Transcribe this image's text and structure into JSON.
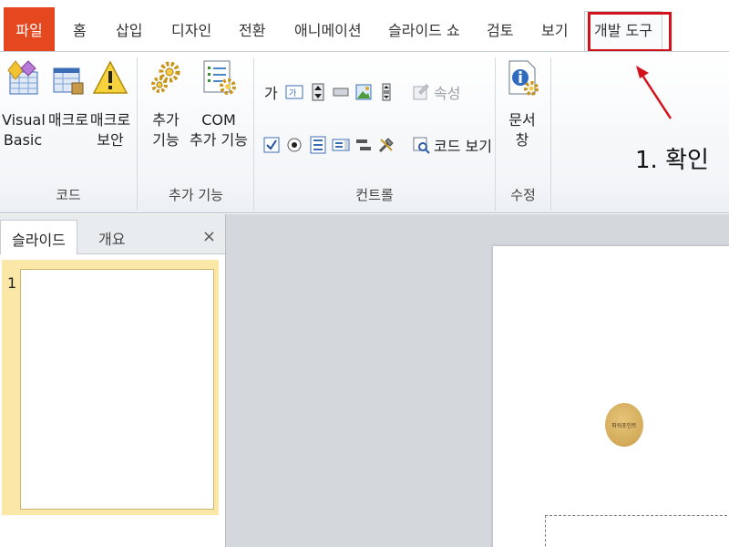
{
  "tabs": {
    "file": "파일",
    "items": [
      {
        "id": "home",
        "label": "홈"
      },
      {
        "id": "insert",
        "label": "삽입"
      },
      {
        "id": "design",
        "label": "디자인"
      },
      {
        "id": "transitions",
        "label": "전환"
      },
      {
        "id": "animations",
        "label": "애니메이션"
      },
      {
        "id": "slideshow",
        "label": "슬라이드 쇼"
      },
      {
        "id": "review",
        "label": "검토"
      },
      {
        "id": "view",
        "label": "보기"
      },
      {
        "id": "developer",
        "label": "개발 도구"
      }
    ]
  },
  "ribbon": {
    "code": {
      "label": "코드",
      "visual_basic_1": "Visual",
      "visual_basic_2": "Basic",
      "macro": "매크로",
      "macro_security_1": "매크로",
      "macro_security_2": "보안"
    },
    "addins": {
      "label": "추가 기능",
      "addins_1": "추가",
      "addins_2": "기능",
      "com_1": "COM",
      "com_2": "추가 기능"
    },
    "controls": {
      "label": "컨트롤",
      "properties": "속성",
      "view_code": "코드 보기"
    },
    "modify": {
      "label": "수정",
      "doc_panel_1": "문서",
      "doc_panel_2": "창"
    }
  },
  "annotation": {
    "text": "1. 확인",
    "color": "#d3131b"
  },
  "pane": {
    "slides_tab": "슬라이드",
    "outline_tab": "개요",
    "close": "×",
    "slide_number": "1"
  },
  "stamp_text": "파워포인트",
  "colors": {
    "file_tab": "#e5481f",
    "accent_red": "#d3131b",
    "thumb_selected": "#fbe7a8"
  }
}
